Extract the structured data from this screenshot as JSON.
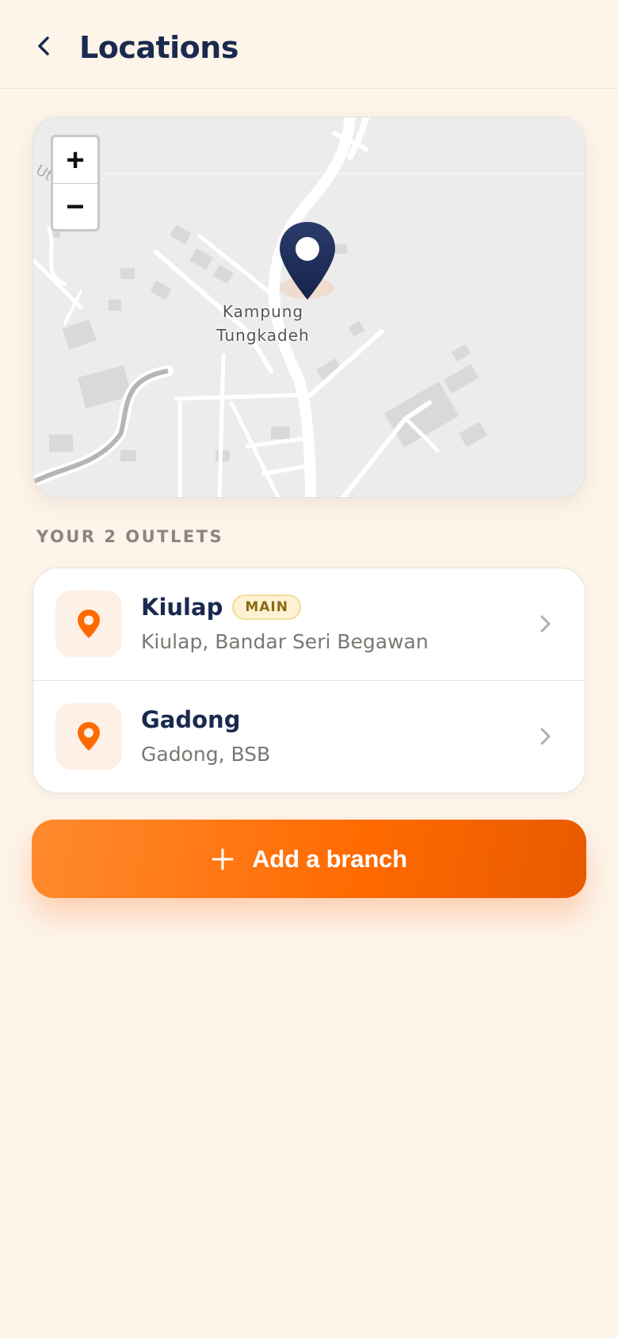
{
  "header": {
    "back_icon": "chevron-left-icon",
    "title": "Locations"
  },
  "map": {
    "zoom_in_label": "+",
    "zoom_out_label": "−",
    "place_label_line1": "Kampung",
    "place_label_line2": "Tungkadeh",
    "pin_icon": "map-pin-icon",
    "pin_color": "#1e2d55"
  },
  "outlets_section": {
    "label": "YOUR 2 OUTLETS"
  },
  "outlets": [
    {
      "name": "Kiulap",
      "badge": "MAIN",
      "address": "Kiulap, Bandar Seri Begawan",
      "icon": "location-pin-icon"
    },
    {
      "name": "Gadong",
      "address": "Gadong, BSB",
      "icon": "location-pin-icon"
    }
  ],
  "add_button": {
    "icon": "plus-icon",
    "label": "Add a branch"
  },
  "colors": {
    "background": "#fdf4ea",
    "accent": "#ff6a00",
    "navy": "#1a2a4f",
    "badge_bg": "#fdf3d4",
    "badge_text": "#8a6a12"
  }
}
